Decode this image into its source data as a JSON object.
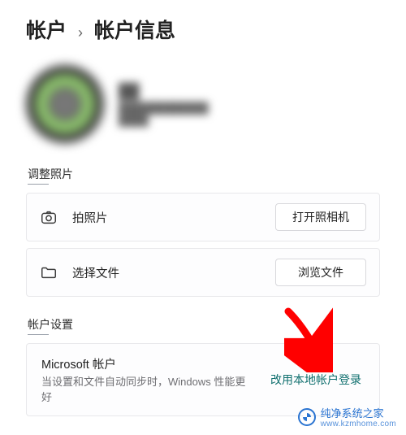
{
  "breadcrumb": {
    "parent": "帐户",
    "current": "帐户信息"
  },
  "profile": {
    "display_name": "██",
    "subtitle1": "████████████",
    "subtitle2": "████"
  },
  "sections": {
    "adjust_photo": {
      "label": "调整照片",
      "items": [
        {
          "icon": "camera-icon",
          "label": "拍照片",
          "action": "打开照相机"
        },
        {
          "icon": "folder-icon",
          "label": "选择文件",
          "action": "浏览文件"
        }
      ]
    },
    "account_settings": {
      "label": "帐户设置",
      "items": [
        {
          "title": "Microsoft 帐户",
          "desc": "当设置和文件自动同步时，Windows 性能更好",
          "action": "改用本地帐户登录"
        }
      ]
    }
  },
  "watermark": {
    "title": "纯净系统之家",
    "url": "www.kzmhome.com"
  },
  "colors": {
    "link": "#0f6f6e",
    "border": "#e8e8eb",
    "arrow": "#ff0000",
    "brand": "#2a74d1"
  }
}
